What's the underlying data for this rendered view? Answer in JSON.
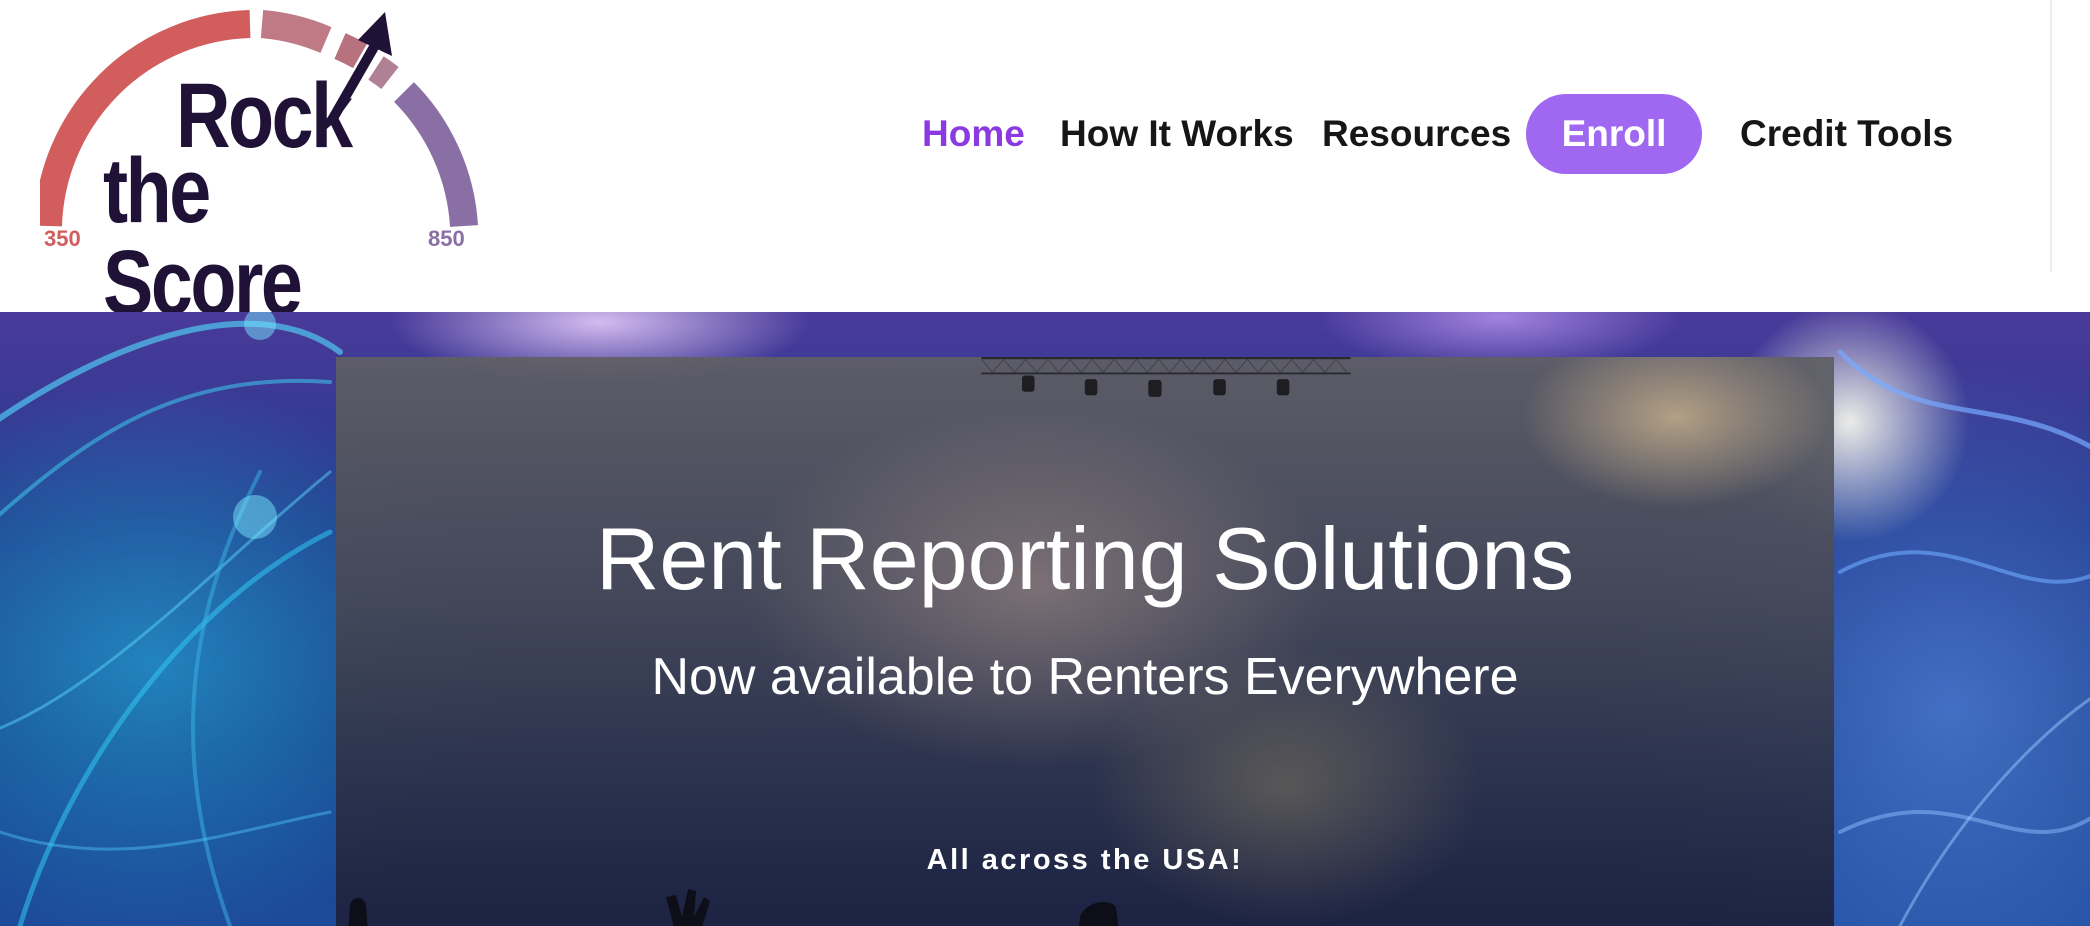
{
  "header": {
    "logo": {
      "line1": "Rock",
      "line2": "the Score",
      "scale_min": "350",
      "scale_max": "850",
      "colors": {
        "red": "#d25d5d",
        "rose": "#b8727f",
        "purple": "#8a6fa5",
        "ink": "#1f1236"
      }
    },
    "nav": {
      "items": [
        {
          "label": "Home",
          "active": true
        },
        {
          "label": "How It Works"
        },
        {
          "label": "Resources"
        },
        {
          "label": "Enroll",
          "style": "pill"
        },
        {
          "label": "Credit Tools"
        }
      ],
      "active_color": "#8a3ae0",
      "enroll_bg": "#a067f0"
    }
  },
  "hero": {
    "title": "Rent Reporting Solutions",
    "subtitle": "Now available to Renters Everywhere",
    "tagline": "All across the USA!"
  }
}
